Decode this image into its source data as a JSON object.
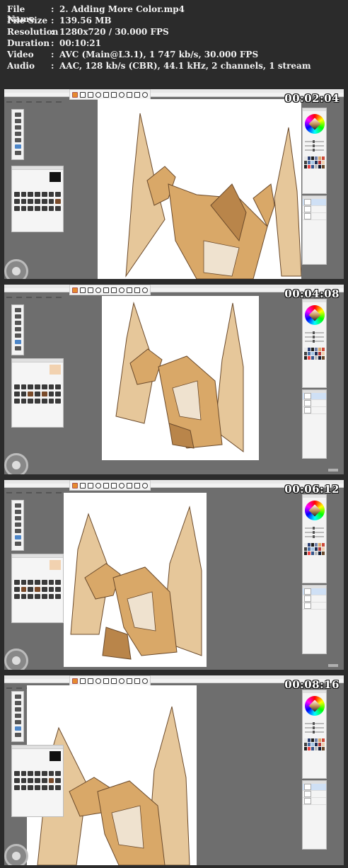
{
  "info": {
    "file_name": {
      "key": "File Name",
      "sep": ":",
      "value": "2. Adding More Color.mp4"
    },
    "file_size": {
      "key": "File Size",
      "sep": ":",
      "value": "139.56 MB"
    },
    "resolution": {
      "key": "Resolution",
      "sep": ":",
      "value": "1280x720 / 30.000 FPS"
    },
    "duration": {
      "key": "Duration",
      "sep": ":",
      "value": "00:10:21"
    },
    "video": {
      "key": "Video",
      "sep": ":",
      "value": "AVC (Main@L3.1), 1 747 kb/s, 30.000 FPS"
    },
    "audio": {
      "key": "Audio",
      "sep": ":",
      "value": "AAC, 128 kb/s (CBR), 44.1 kHz, 2 channels, 1 stream"
    }
  },
  "frames": [
    {
      "timestamp": "00:02:04"
    },
    {
      "timestamp": "00:04:08"
    },
    {
      "timestamp": "00:06:12"
    },
    {
      "timestamp": "00:08:16"
    }
  ],
  "colors": {
    "background": "#2b2b2b",
    "workspace": "#6e6e6e",
    "dragon_fill": "#d9a868",
    "dragon_shadow": "#b9854a",
    "dragon_outline": "#6b4a2b"
  },
  "icons": [
    "toolbar-icons",
    "color-wheel",
    "brush-icons",
    "layer-thumbnails",
    "lagoon-puck-icon"
  ]
}
